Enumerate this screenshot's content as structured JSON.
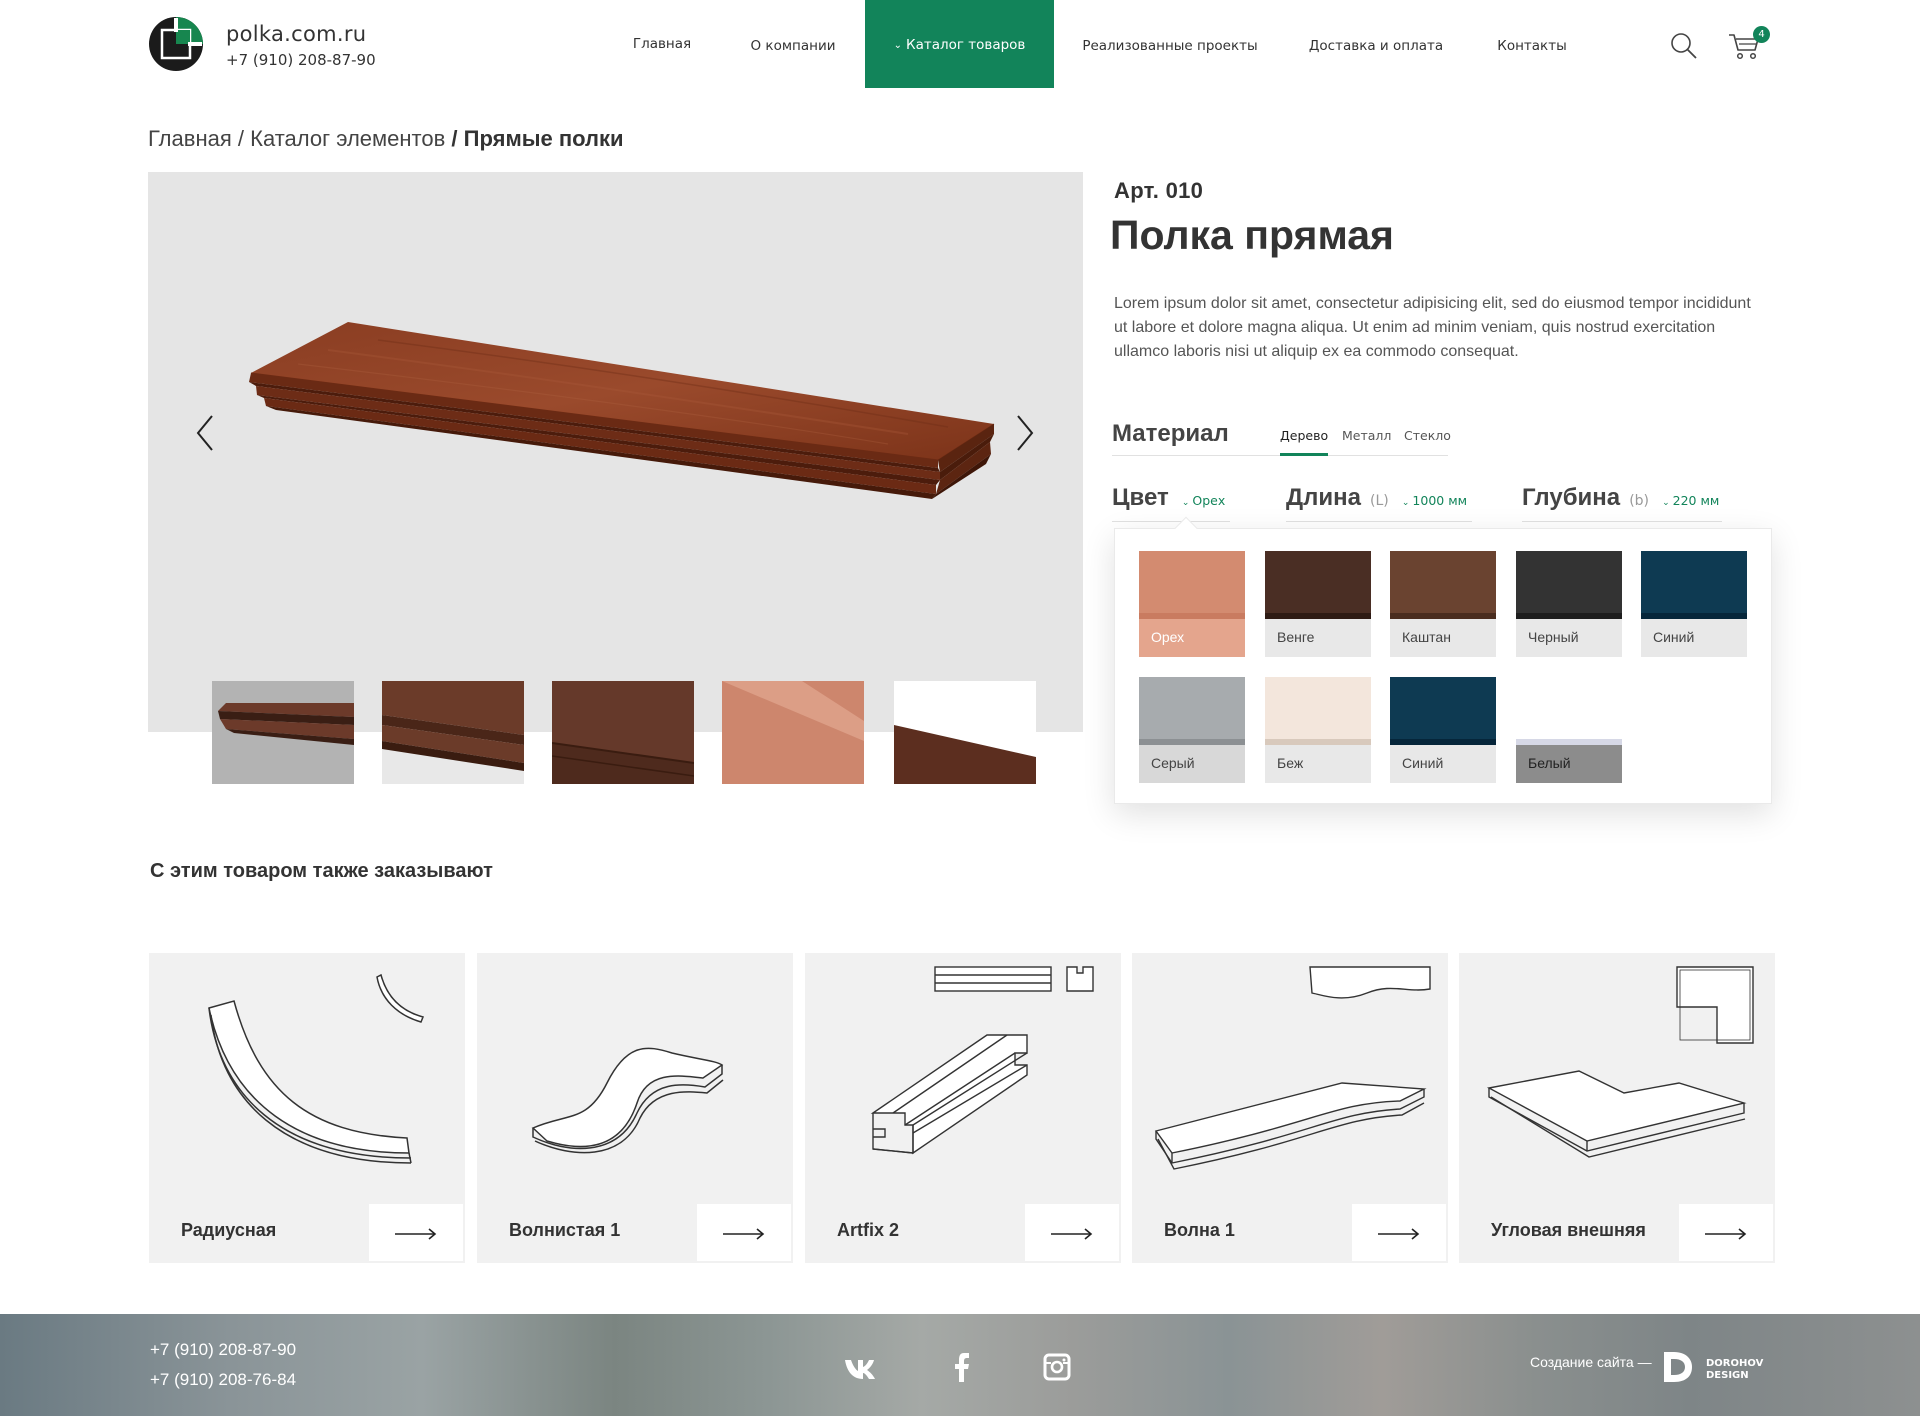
{
  "header": {
    "site_name": "polka.com.ru",
    "phone": "+7 (910) 208-87-90",
    "nav": [
      "Главная",
      "О компании",
      "Каталог товаров",
      "Реализованные проекты",
      "Доставка и оплата",
      "Контакты"
    ],
    "nav_active": "Каталог товаров",
    "cart_count": "4"
  },
  "breadcrumb": {
    "home": "Главная",
    "sep": "/",
    "catalog": "Каталог элементов",
    "current": "Прямые полки"
  },
  "gallery": {
    "thumbnail_count": 5
  },
  "product": {
    "article": "Арт. 010",
    "title": "Полка прямая",
    "description": "Lorem ipsum dolor sit amet, consectetur adipisicing elit, sed do eiusmod tempor incididunt ut labore et dolore magna aliqua. Ut enim ad minim veniam, quis nostrud exercitation ullamco laboris nisi ut aliquip ex ea commodo consequat.",
    "material": {
      "label": "Материал",
      "tabs": [
        "Дерево",
        "Металл",
        "Стекло"
      ],
      "active": "Дерево"
    },
    "params": {
      "color": {
        "label": "Цвет",
        "value": "Орех"
      },
      "length": {
        "label": "Длина",
        "symbol": "(L)",
        "value": "1000 мм"
      },
      "depth": {
        "label": "Глубина",
        "symbol": "(b)",
        "value": "220 мм"
      }
    },
    "colors": [
      {
        "name": "Орех",
        "top": "#d38b70",
        "bottom": "#e4a58d",
        "edge": "#c97b60",
        "selected": true
      },
      {
        "name": "Венге",
        "top": "#4a2e24",
        "bottom": "#e8e8e8",
        "edge": "#2e1b14"
      },
      {
        "name": "Каштан",
        "top": "#6a4330",
        "bottom": "#e8e8e8",
        "edge": "#4a2d1f"
      },
      {
        "name": "Черный",
        "top": "#333333",
        "bottom": "#e8e8e8",
        "edge": "#1e1e1e"
      },
      {
        "name": "Синий",
        "top": "#0e3a52",
        "bottom": "#e8e8e8",
        "edge": "#06263a"
      },
      {
        "name": "Серый",
        "top": "#a7abae",
        "bottom": "#d8d8d8",
        "edge": "#8c9093"
      },
      {
        "name": "Беж",
        "top": "#f3e6dc",
        "bottom": "#e8e8e8",
        "edge": "#d8c9bc"
      },
      {
        "name": "Синий",
        "top": "#0e3a52",
        "bottom": "#e8e8e8",
        "edge": "#06263a"
      },
      {
        "name": "Белый",
        "top": "#ffffff",
        "bottom": "#8c8c8c",
        "edge": "#d6d8e6"
      }
    ]
  },
  "related": {
    "title": "С этим товаром также заказывают",
    "items": [
      "Радиусная",
      "Волнистая 1",
      "Artfix 2",
      "Волна 1",
      "Угловая внешняя"
    ]
  },
  "footer": {
    "phones": [
      "+7 (910) 208-87-90",
      "+7 (910) 208-76-84"
    ],
    "social": [
      "vk-icon",
      "facebook-icon",
      "instagram-icon"
    ],
    "credit": "Создание сайта —",
    "credit_brand": [
      "DOROHOV",
      "DESIGN"
    ]
  },
  "colors": {
    "accent": "#12845a",
    "gallery_bg": "#e5e5e5",
    "card_bg": "#f1f1f1"
  }
}
